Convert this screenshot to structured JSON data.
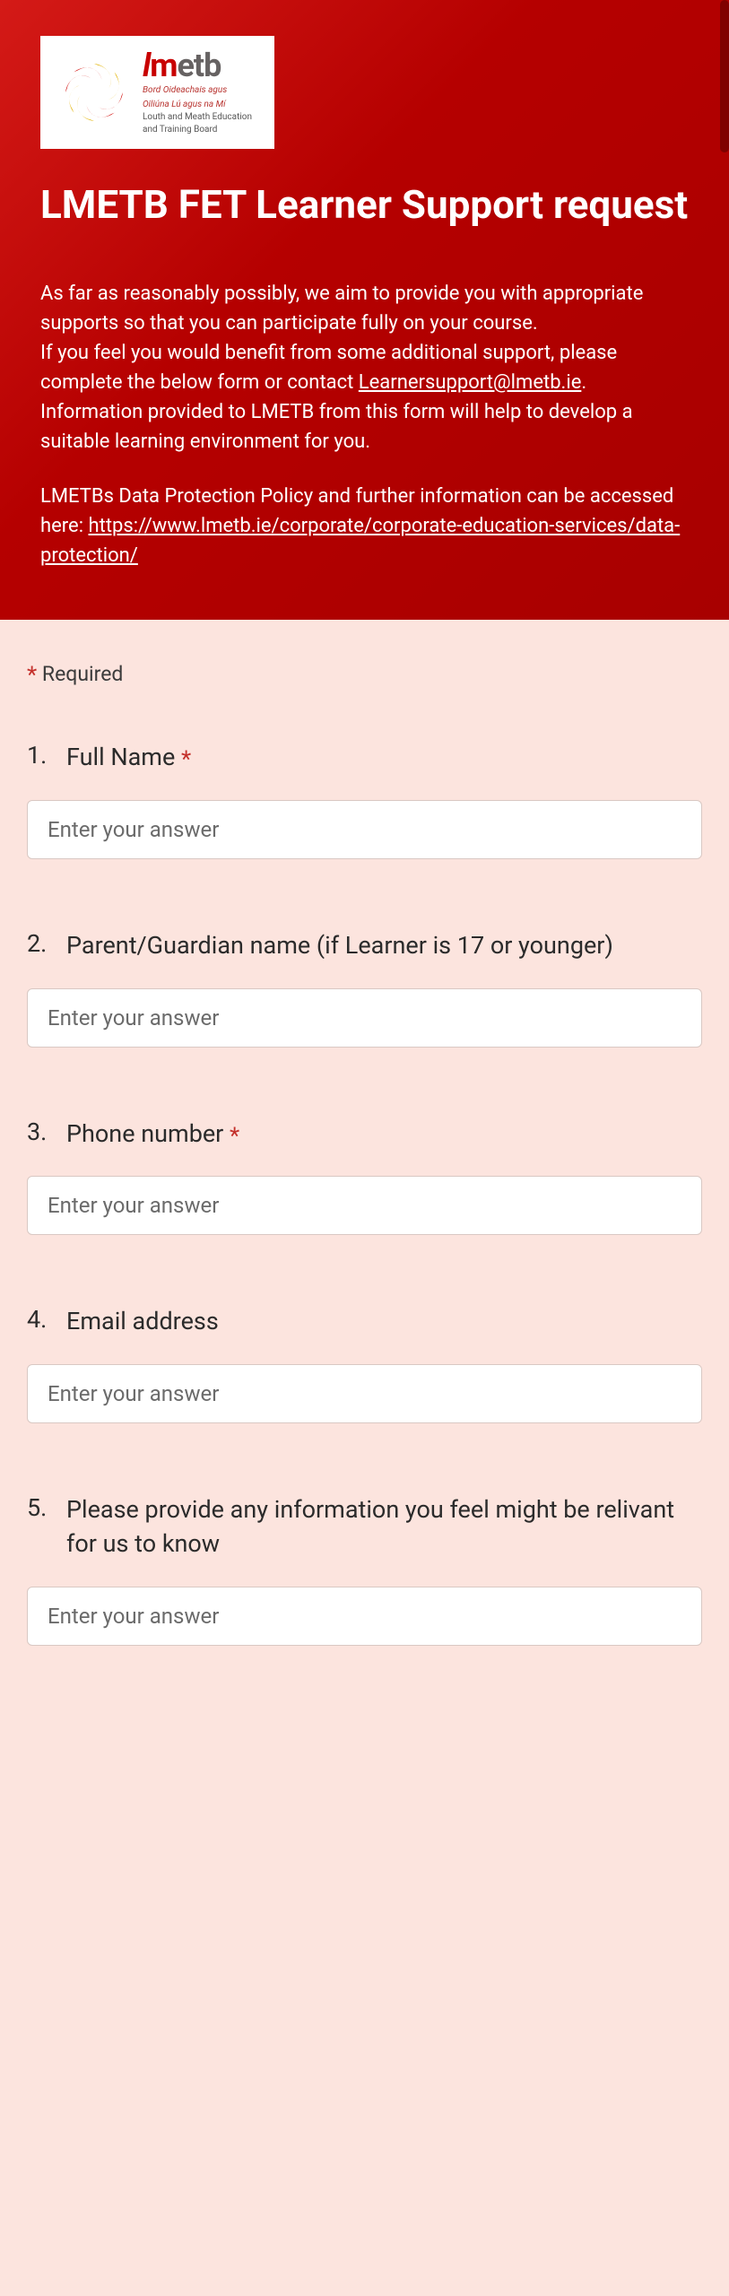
{
  "header": {
    "logo": {
      "brand_l": "l",
      "brand_m": "m",
      "brand_e": "e",
      "brand_t": "t",
      "brand_b": "b",
      "tag1": "Bord Oideachais agus",
      "tag2": "Oiliúna Lú agus na Mí",
      "tag3": "Louth and Meath Education",
      "tag4": "and Training Board"
    },
    "title": "LMETB FET Learner Support request",
    "intro1a": "As far as reasonably possibly, we aim to provide you with appropriate supports so that you can participate fully on your course.",
    "intro1b": "If you feel you would benefit from some additional support, please complete the below form or contact ",
    "email": "Learnersupport@lmetb.ie",
    "intro1c": ".",
    "intro1d": "Information provided to LMETB from this form will help to develop a suitable learning environment for you.",
    "intro2a": "LMETBs Data Protection Policy and further information can be accessed here: ",
    "policy_link": "https://www.lmetb.ie/corporate/corporate-education-services/data-protection/"
  },
  "form": {
    "required_label": " Required",
    "star": "*",
    "placeholder": "Enter your answer",
    "questions": [
      {
        "num": "1.",
        "label": "Full Name ",
        "required": true
      },
      {
        "num": "2.",
        "label": "Parent/Guardian name (if Learner is 17 or younger)",
        "required": false
      },
      {
        "num": "3.",
        "label": "Phone number ",
        "required": true
      },
      {
        "num": "4.",
        "label": "Email address",
        "required": false
      },
      {
        "num": "5.",
        "label": "Please provide any information you feel might be relivant for us to know",
        "required": false
      }
    ]
  }
}
